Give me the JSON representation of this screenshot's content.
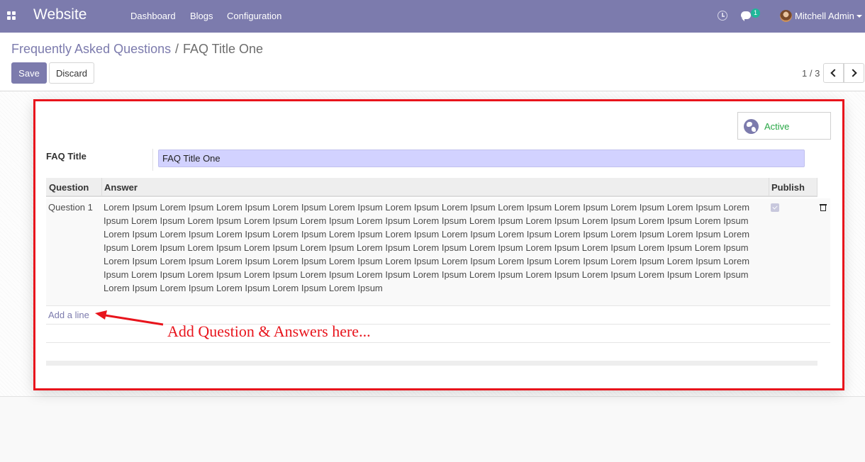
{
  "navbar": {
    "app_title": "Website",
    "menu": [
      "Dashboard",
      "Blogs",
      "Configuration"
    ],
    "messages_count": "1",
    "user_name": "Mitchell Admin"
  },
  "breadcrumb": {
    "parent": "Frequently Asked Questions",
    "separator": "/",
    "current": "FAQ Title One"
  },
  "buttons": {
    "save": "Save",
    "discard": "Discard"
  },
  "pager": {
    "value": "1 / 3"
  },
  "status_button": {
    "label": "Active"
  },
  "form": {
    "title_label": "FAQ Title",
    "title_value": "FAQ Title One"
  },
  "table": {
    "headers": {
      "question": "Question",
      "answer": "Answer",
      "publish": "Publish"
    },
    "rows": [
      {
        "question": "Question 1",
        "answer": "Lorem Ipsum Lorem Ipsum Lorem Ipsum Lorem Ipsum Lorem Ipsum Lorem Ipsum Lorem Ipsum Lorem Ipsum Lorem Ipsum Lorem Ipsum Lorem Ipsum Lorem Ipsum Lorem Ipsum Lorem Ipsum Lorem Ipsum Lorem Ipsum Lorem Ipsum Lorem Ipsum Lorem Ipsum Lorem Ipsum Lorem Ipsum Lorem Ipsum Lorem Ipsum Lorem Ipsum Lorem Ipsum Lorem Ipsum Lorem Ipsum Lorem Ipsum Lorem Ipsum Lorem Ipsum Lorem Ipsum Lorem Ipsum Lorem Ipsum Lorem Ipsum Lorem Ipsum Lorem Ipsum Lorem Ipsum Lorem Ipsum Lorem Ipsum Lorem Ipsum Lorem Ipsum Lorem Ipsum Lorem Ipsum Lorem Ipsum Lorem Ipsum Lorem Ipsum Lorem Ipsum Lorem Ipsum Lorem Ipsum Lorem Ipsum Lorem Ipsum Lorem Ipsum Lorem Ipsum Lorem Ipsum Lorem Ipsum Lorem Ipsum Lorem Ipsum Lorem Ipsum Lorem Ipsum Lorem Ipsum Lorem Ipsum Lorem Ipsum Lorem Ipsum Lorem Ipsum Lorem Ipsum Lorem Ipsum Lorem Ipsum Lorem Ipsum Lorem Ipsum Lorem Ipsum Lorem Ipsum Lorem Ipsum Lorem Ipsum Lorem Ipsum",
        "publish": true
      }
    ],
    "add_line": "Add a line"
  },
  "annotation": {
    "text": "Add Question & Answers here..."
  },
  "colors": {
    "brand": "#7c7bad",
    "highlight": "#e8141c",
    "active": "#28a745",
    "input_bg": "#d2d2ff"
  },
  "icons": [
    "apps-icon",
    "clock-icon",
    "chat-icon",
    "avatar",
    "chevron-left-icon",
    "chevron-right-icon",
    "globe-icon",
    "trash-icon",
    "arrow-icon"
  ]
}
